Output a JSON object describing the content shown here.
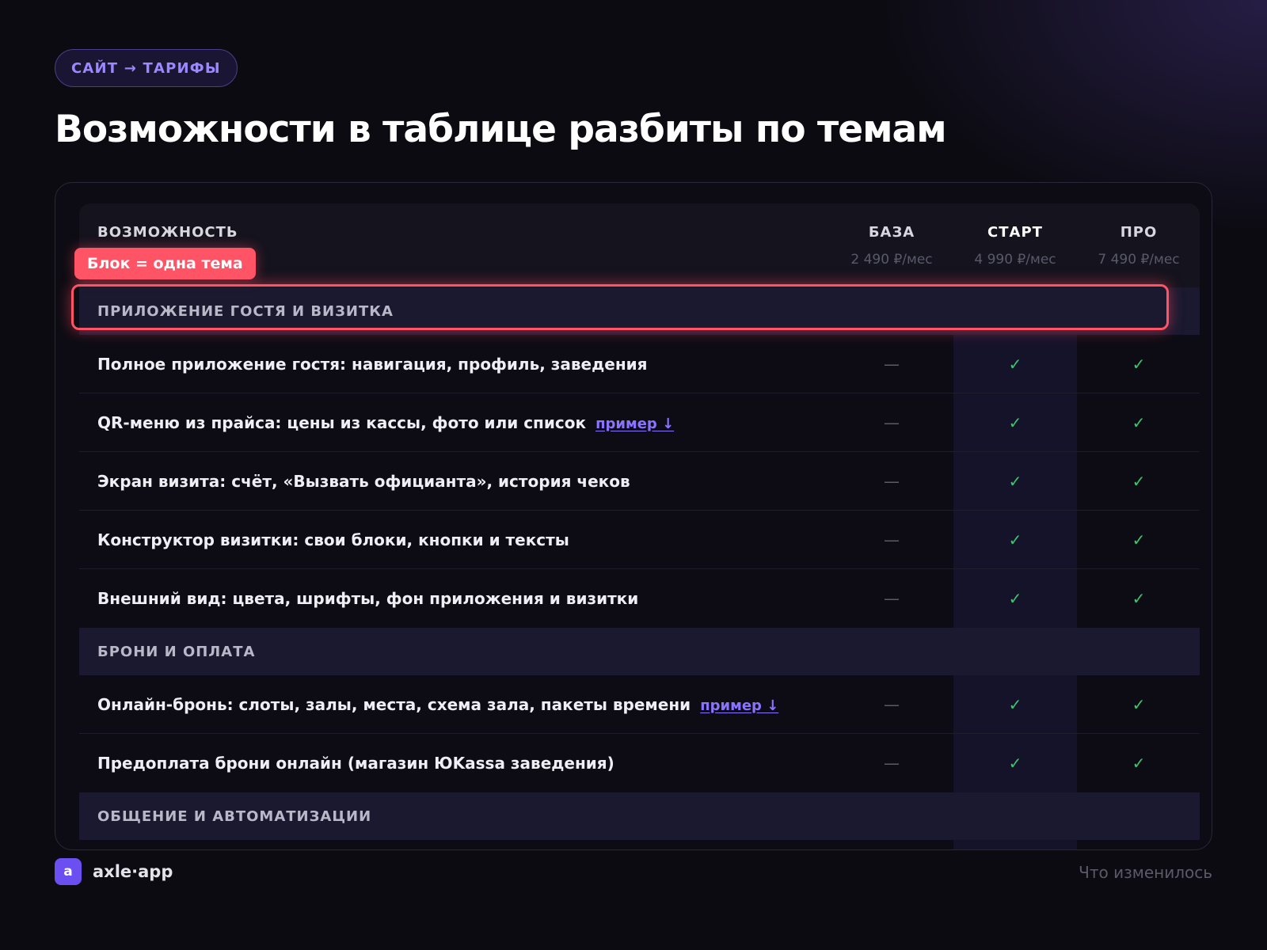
{
  "breadcrumb": "САЙТ → ТАРИФЫ",
  "title": "Возможности в таблице разбиты по темам",
  "table": {
    "feature_header": "ВОЗМОЖНОСТЬ",
    "plans": [
      {
        "name": "БАЗА",
        "price": "2 490 ₽/мес"
      },
      {
        "name": "СТАРТ",
        "price": "4 990 ₽/мес"
      },
      {
        "name": "ПРО",
        "price": "7 490 ₽/мес"
      }
    ],
    "sections": [
      {
        "title": "ПРИЛОЖЕНИЕ ГОСТЯ И ВИЗИТКА",
        "rows": [
          {
            "feature": "Полное приложение гостя: навигация, профиль, заведения",
            "values": [
              "—",
              "✓",
              "✓"
            ]
          },
          {
            "feature": "QR-меню из прайса: цены из кассы, фото или список",
            "link": "пример ↓",
            "values": [
              "—",
              "✓",
              "✓"
            ]
          },
          {
            "feature": "Экран визита: счёт, «Вызвать официанта», история чеков",
            "values": [
              "—",
              "✓",
              "✓"
            ]
          },
          {
            "feature": "Конструктор визитки: свои блоки, кнопки и тексты",
            "values": [
              "—",
              "✓",
              "✓"
            ]
          },
          {
            "feature": "Внешний вид: цвета, шрифты, фон приложения и визитки",
            "values": [
              "—",
              "✓",
              "✓"
            ]
          }
        ]
      },
      {
        "title": "БРОНИ И ОПЛАТА",
        "rows": [
          {
            "feature": "Онлайн-бронь: слоты, залы, места, схема зала, пакеты времени",
            "link": "пример ↓",
            "values": [
              "—",
              "✓",
              "✓"
            ]
          },
          {
            "feature": "Предоплата брони онлайн (магазин ЮKassa заведения)",
            "values": [
              "—",
              "✓",
              "✓"
            ]
          }
        ]
      },
      {
        "title": "ОБЩЕНИЕ И АВТОМАТИЗАЦИИ",
        "rows": []
      }
    ]
  },
  "callout": "Блок = одна тема",
  "brand": {
    "logo_letter": "a",
    "name": "axle·app"
  },
  "footer_note": "Что изменилось",
  "colors": {
    "accent": "#6b4ff0",
    "highlight": "#ff5466",
    "check": "#38c96a"
  },
  "icons": {
    "check": "check-icon",
    "dash": "dash-icon"
  }
}
